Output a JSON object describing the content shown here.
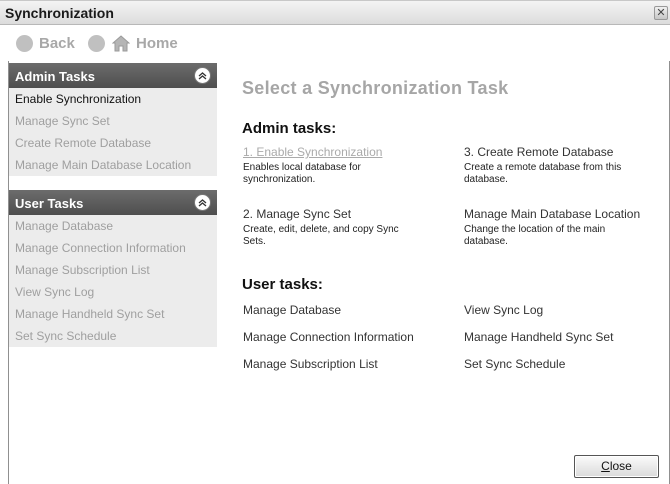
{
  "window": {
    "title": "Synchronization",
    "close_glyph": "✕"
  },
  "nav": {
    "back_label": "Back",
    "forward_label": "",
    "home_label": "Home"
  },
  "sidebar": {
    "admin": {
      "header": "Admin Tasks",
      "items": [
        {
          "label": "Enable Synchronization",
          "active": true
        },
        {
          "label": "Manage Sync Set",
          "active": false
        },
        {
          "label": "Create Remote Database",
          "active": false
        },
        {
          "label": "Manage Main Database Location",
          "active": false
        }
      ]
    },
    "user": {
      "header": "User Tasks",
      "items": [
        {
          "label": "Manage Database"
        },
        {
          "label": "Manage Connection Information"
        },
        {
          "label": "Manage Subscription List"
        },
        {
          "label": "View Sync Log"
        },
        {
          "label": "Manage Handheld Sync Set"
        },
        {
          "label": "Set Sync Schedule"
        }
      ]
    }
  },
  "main": {
    "title": "Select a Synchronization Task",
    "admin_heading": "Admin tasks:",
    "admin_tasks": [
      {
        "link": "1. Enable Synchronization",
        "desc": "Enables local database for synchronization."
      },
      {
        "link": "3. Create Remote Database",
        "desc": "Create a remote database from this database."
      },
      {
        "link": "2. Manage Sync Set",
        "desc": "Create, edit, delete, and copy Sync Sets."
      },
      {
        "link": "Manage Main Database Location",
        "desc": "Change the location of the main database."
      }
    ],
    "user_heading": "User tasks:",
    "user_tasks": [
      "Manage Database",
      "View Sync Log",
      "Manage Connection Information",
      "Manage Handheld Sync Set",
      "Manage Subscription List",
      "Set Sync Schedule"
    ]
  },
  "footer": {
    "close_prefix": "",
    "close_mnemonic": "C",
    "close_rest": "lose"
  },
  "icons": {
    "back": "back-arrow-icon",
    "forward": "forward-arrow-icon",
    "home": "home-icon",
    "collapse": "chevron-up-icon"
  },
  "colors": {
    "header_bg": "#5a5a5a",
    "sidebar_bg": "#ececec",
    "disabled_text": "#9f9f9f"
  }
}
